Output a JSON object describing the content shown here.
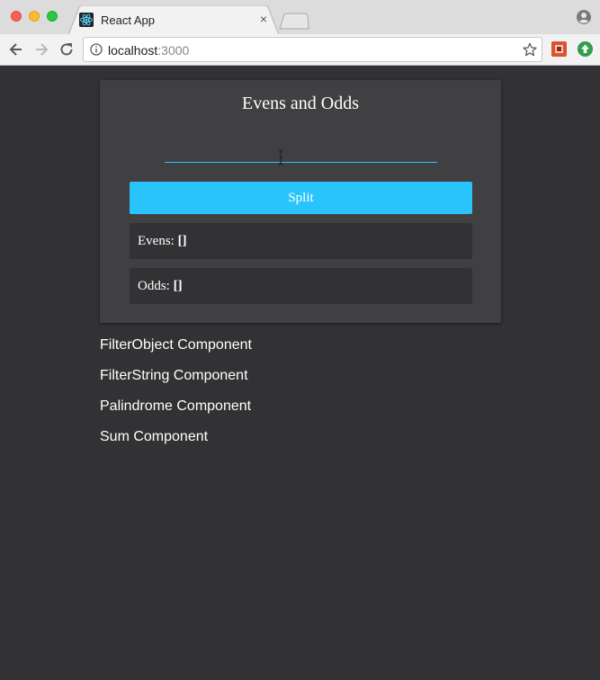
{
  "browser": {
    "tab_title": "React App",
    "tab_close": "×",
    "url_host": "localhost",
    "url_port": ":3000"
  },
  "card": {
    "title": "Evens and Odds",
    "input_value": "",
    "split_label": "Split",
    "evens_label": "Evens: ",
    "evens_value": "[]",
    "odds_label": "Odds: ",
    "odds_value": "[]"
  },
  "components": [
    "FilterObject Component",
    "FilterString Component",
    "Palindrome Component",
    "Sum Component"
  ],
  "colors": {
    "page_bg": "#323234",
    "card_bg": "#404042",
    "accent": "#29c4fb",
    "result_bg": "#323234"
  },
  "icons": {
    "favicon": "react-logo-icon",
    "info": "info-icon",
    "star": "star-icon",
    "profile": "profile-icon",
    "cursor": "text-cursor-icon"
  }
}
